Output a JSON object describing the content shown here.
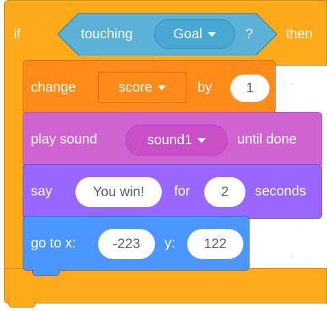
{
  "if_block": {
    "if_label": "if",
    "then_label": "then",
    "condition": {
      "touching_label": "touching",
      "target_value": "Goal",
      "question_mark": "?"
    }
  },
  "change_block": {
    "change_label": "change",
    "variable_value": "score",
    "by_label": "by",
    "amount_value": "1"
  },
  "sound_block": {
    "play_label": "play sound",
    "sound_value": "sound1",
    "until_label": "until done"
  },
  "say_block": {
    "say_label": "say",
    "message_value": "You win!",
    "for_label": "for",
    "seconds_value": "2",
    "seconds_label": "seconds"
  },
  "goto_block": {
    "goto_label": "go to x:",
    "x_value": "-223",
    "y_label": "y:",
    "y_value": "122"
  },
  "colors": {
    "control": "#ffab19",
    "sensing": "#5cb1d6",
    "variables": "#ff8c1a",
    "sound": "#cf63cf",
    "looks": "#9966ff",
    "motion": "#4c97ff"
  },
  "icons": {
    "dropdown": "dropdown-caret-icon"
  }
}
